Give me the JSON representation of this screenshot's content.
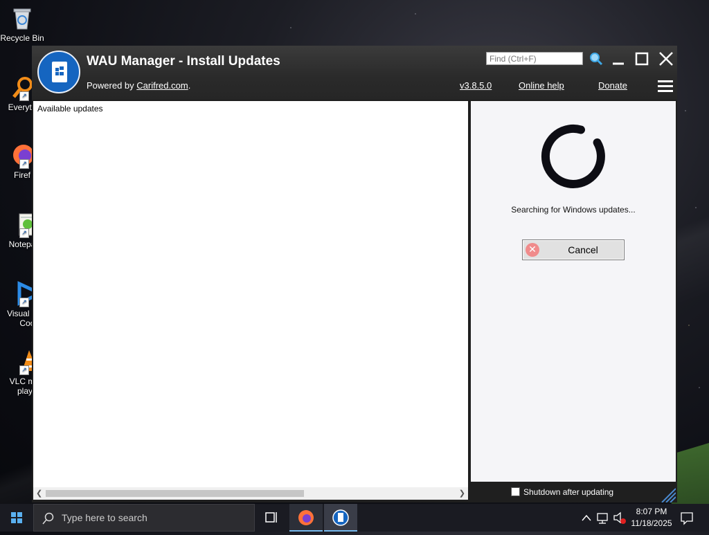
{
  "desktop": {
    "icons": [
      {
        "label": "Recycle Bin",
        "name": "recycle-bin"
      },
      {
        "label": "Everyth",
        "name": "everything"
      },
      {
        "label": "Firef",
        "name": "firefox"
      },
      {
        "label": "Notepa",
        "name": "notepad"
      },
      {
        "label": "Visual S",
        "label2": "Coc",
        "name": "visual-studio-code"
      },
      {
        "label": "VLC m",
        "label2": "play",
        "name": "vlc-media-player"
      }
    ]
  },
  "window": {
    "title": "WAU Manager - Install Updates",
    "powered_prefix": "Powered by ",
    "powered_link": "Carifred.com",
    "powered_suffix": ".",
    "find_placeholder": "Find (Ctrl+F)",
    "version_link": "v3.8.5.0",
    "help_link": "Online help",
    "donate_link": "Donate",
    "available_updates_label": "Available updates",
    "status_text": "Searching for Windows updates...",
    "cancel_label": "Cancel",
    "shutdown_label": "Shutdown after updating",
    "shutdown_checked": false
  },
  "taskbar": {
    "search_placeholder": "Type here to search",
    "time": "8:07 PM",
    "date": "11/18/2025",
    "pinned": [
      "task-view",
      "firefox",
      "wau-manager"
    ]
  },
  "colors": {
    "window_title_bg": "#2a2a2a",
    "logo_blue": "#1565c0",
    "spinner": "#0d0d14",
    "cancel_icon": "#f08b8b"
  }
}
